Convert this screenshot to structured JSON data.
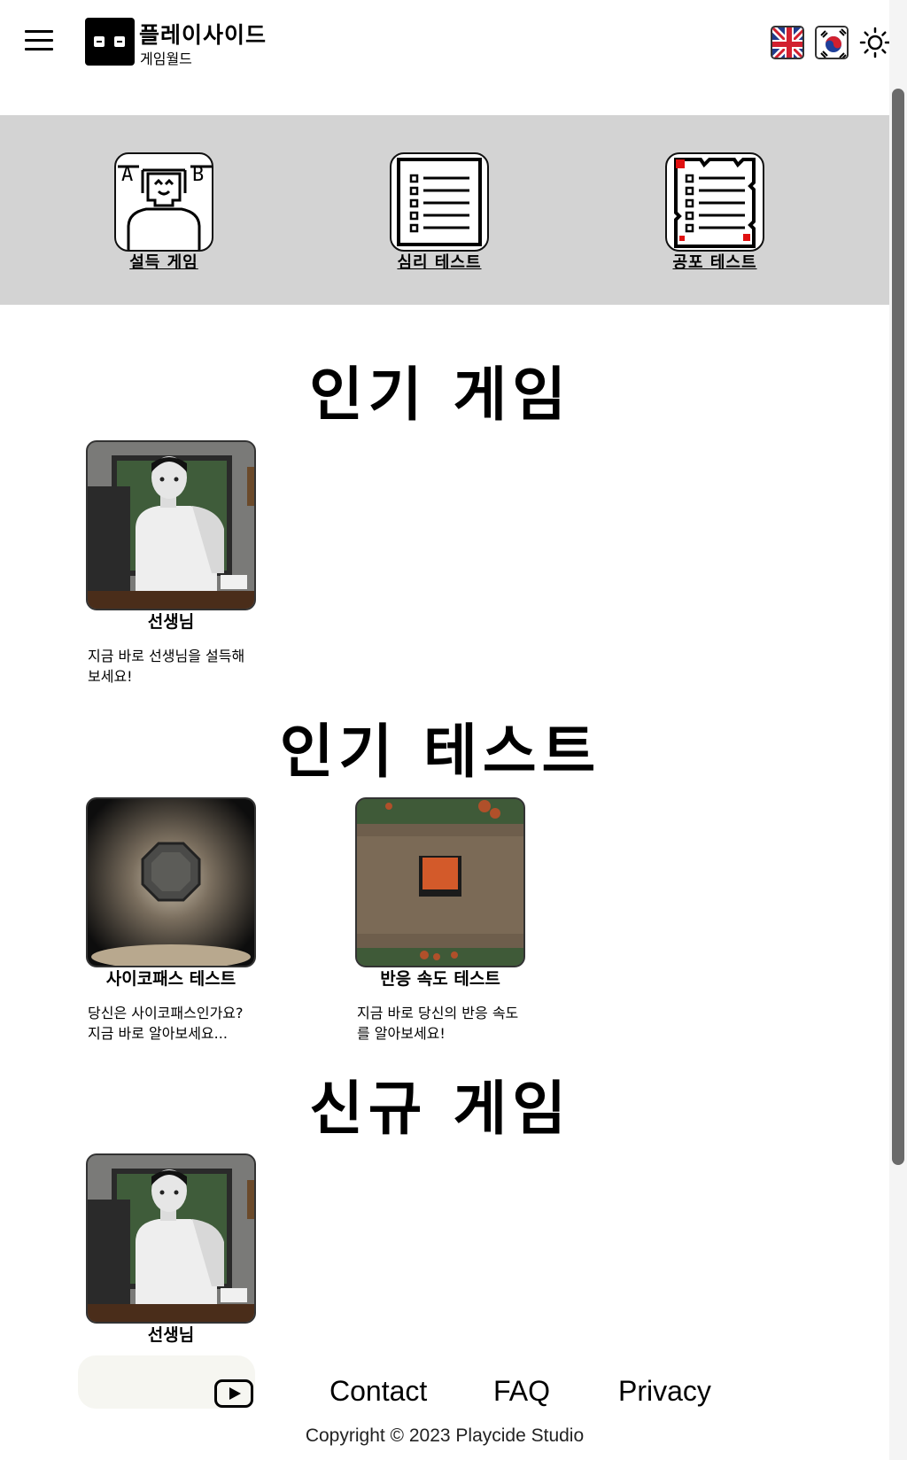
{
  "header": {
    "brand_title": "플레이사이드",
    "brand_subtitle": "게임월드"
  },
  "icons": {
    "menu": "hamburger-menu-icon",
    "lang_en": "uk-flag-icon",
    "lang_kr": "korea-flag-icon",
    "theme": "sun-icon",
    "youtube": "youtube-icon"
  },
  "categories": [
    {
      "label": "설득 게임"
    },
    {
      "label": "심리 테스트"
    },
    {
      "label": "공포 테스트"
    }
  ],
  "sections": {
    "popular_games": {
      "title": "인기 게임",
      "cards": [
        {
          "title": "선생님",
          "desc": "지금 바로 선생님을 설득해보세요!"
        }
      ]
    },
    "popular_tests": {
      "title": "인기 테스트",
      "cards": [
        {
          "title": "사이코패스 테스트",
          "desc": "당신은 사이코패스인가요? 지금 바로 알아보세요..."
        },
        {
          "title": "반응 속도 테스트",
          "desc": "지금 바로 당신의 반응 속도를 알아보세요!"
        }
      ]
    },
    "new_games": {
      "title": "신규 게임",
      "cards": [
        {
          "title": "선생님"
        }
      ]
    }
  },
  "footer": {
    "contact": "Contact",
    "faq": "FAQ",
    "privacy": "Privacy",
    "copyright": "Copyright © 2023 Playcide Studio"
  },
  "colors": {
    "category_band": "#d3d3d3",
    "background": "#ffffff",
    "text": "#000000"
  }
}
